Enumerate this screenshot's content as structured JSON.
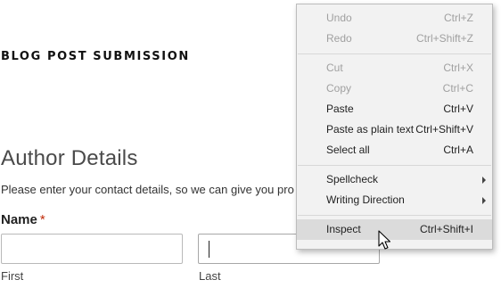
{
  "page": {
    "title": "BLOG POST SUBMISSION"
  },
  "author_section": {
    "title": "Author Details",
    "description": "Please enter your contact details, so we can give you pro",
    "name_label": "Name",
    "required_mark": "*",
    "first_sublabel": "First",
    "last_sublabel": "Last",
    "first_value": "",
    "last_value": ""
  },
  "context_menu": {
    "undo": {
      "label": "Undo",
      "shortcut": "Ctrl+Z",
      "enabled": false
    },
    "redo": {
      "label": "Redo",
      "shortcut": "Ctrl+Shift+Z",
      "enabled": false
    },
    "cut": {
      "label": "Cut",
      "shortcut": "Ctrl+X",
      "enabled": false
    },
    "copy": {
      "label": "Copy",
      "shortcut": "Ctrl+C",
      "enabled": false
    },
    "paste": {
      "label": "Paste",
      "shortcut": "Ctrl+V",
      "enabled": true
    },
    "paste_plain": {
      "label": "Paste as plain text",
      "shortcut": "Ctrl+Shift+V",
      "enabled": true
    },
    "select_all": {
      "label": "Select all",
      "shortcut": "Ctrl+A",
      "enabled": true
    },
    "spellcheck": {
      "label": "Spellcheck",
      "has_submenu": true
    },
    "writing_direction": {
      "label": "Writing Direction",
      "has_submenu": true
    },
    "inspect": {
      "label": "Inspect",
      "shortcut": "Ctrl+Shift+I",
      "hovered": true
    }
  },
  "colors": {
    "required_mark": "#c02b0a",
    "menu_background": "#f2f2f2",
    "menu_hover": "#dbdbdb",
    "disabled_text": "#a0a0a0"
  },
  "icons": {
    "cursor": "mouse-pointer-icon",
    "submenu": "chevron-right-icon"
  }
}
